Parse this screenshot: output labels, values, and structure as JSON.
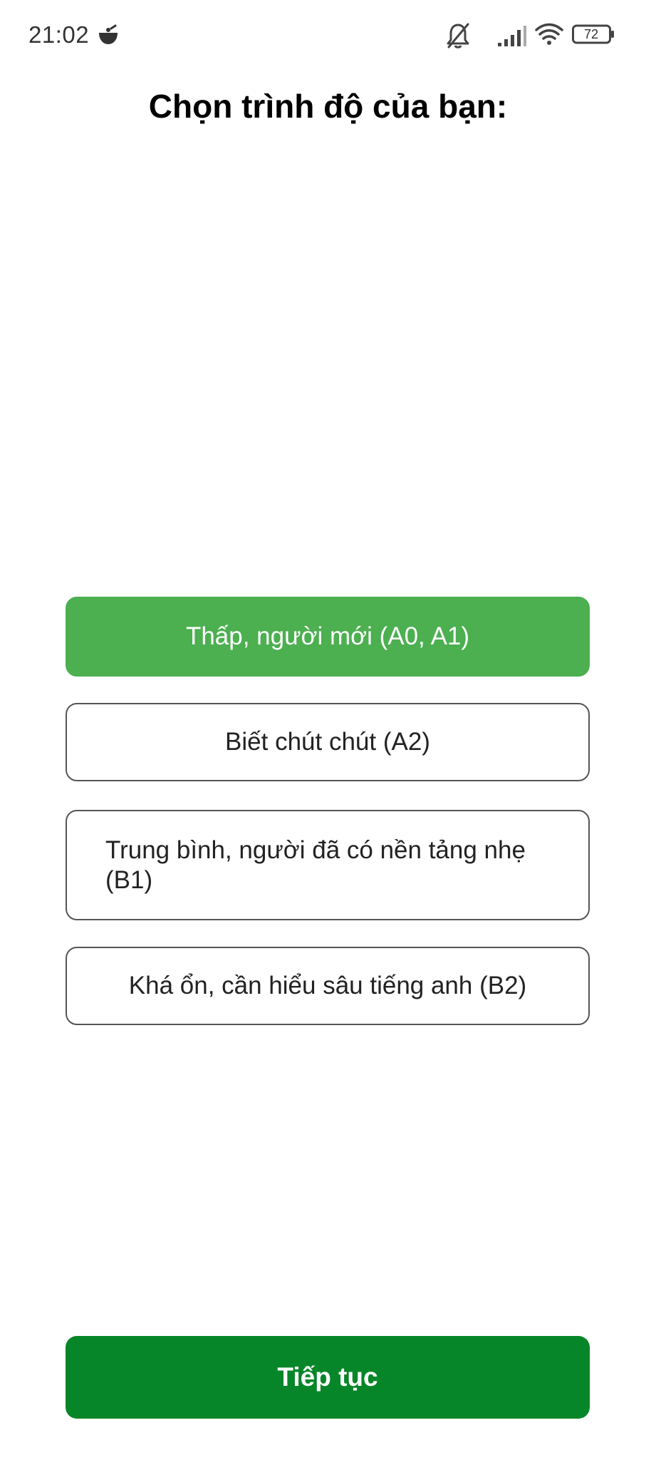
{
  "status_bar": {
    "time": "21:02",
    "battery_level": "72",
    "icons": [
      "app-notification-icon",
      "bell-muted-icon",
      "cellular-signal-icon",
      "wifi-icon",
      "battery-icon"
    ]
  },
  "screen": {
    "title": "Chọn trình độ của bạn:",
    "options": [
      {
        "label": "Thấp, người mới (A0, A1)",
        "selected": true
      },
      {
        "label": "Biết chút chút (A2)",
        "selected": false
      },
      {
        "label": "Trung bình, người đã có nền tảng nhẹ (B1)",
        "selected": false
      },
      {
        "label": "Khá ổn, cần hiểu sâu tiếng anh (B2)",
        "selected": false
      }
    ],
    "continue_label": "Tiếp tục"
  },
  "colors": {
    "selected_option": "#4caf50",
    "continue_button": "#068628",
    "option_border": "#555555"
  }
}
